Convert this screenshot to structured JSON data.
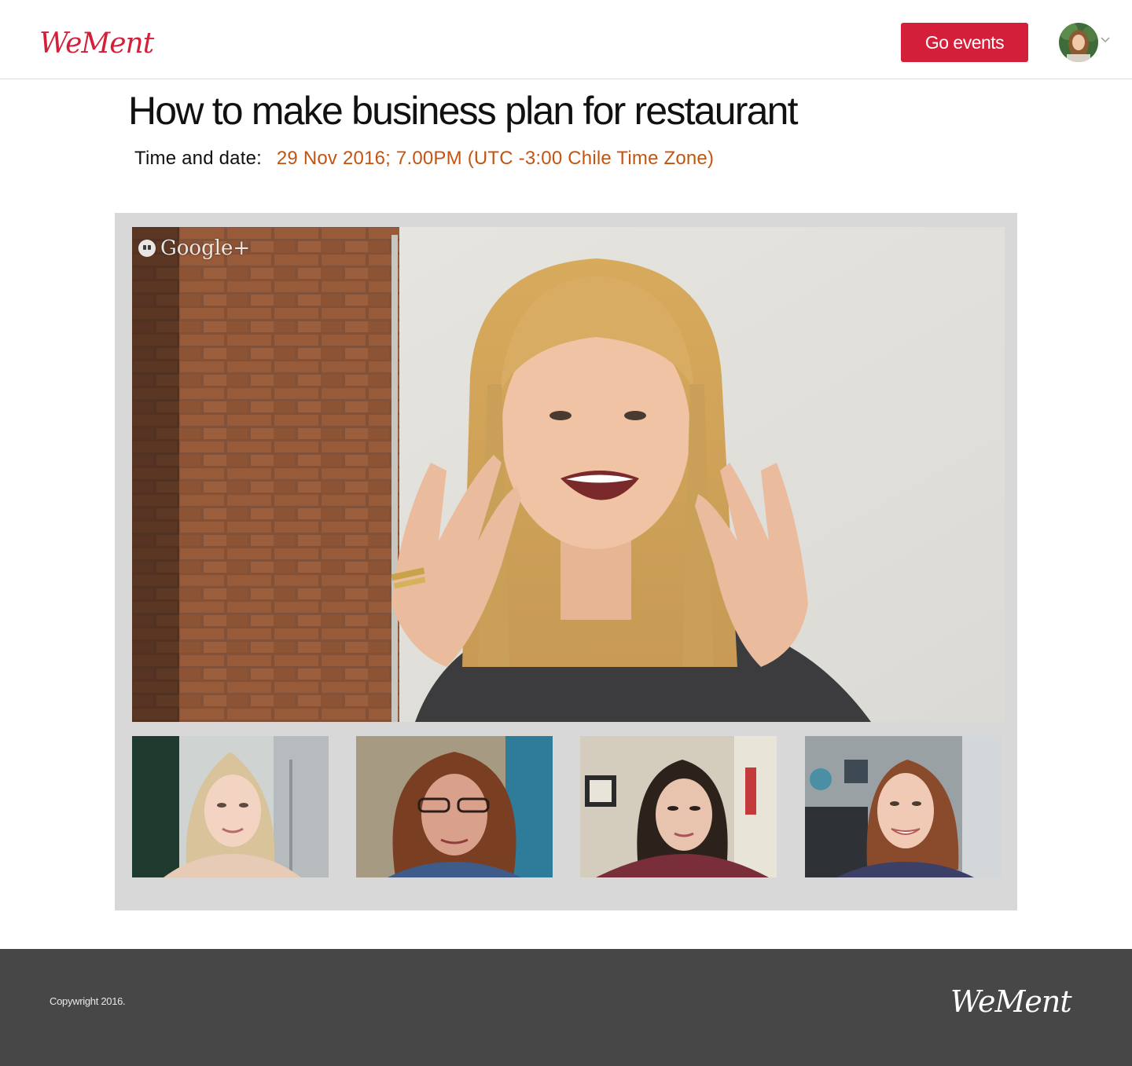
{
  "header": {
    "logo_text": "WeMent",
    "go_events_label": "Go events"
  },
  "event": {
    "title": "How to make business plan for restaurant",
    "time_label": "Time and date:",
    "time_value": "29 Nov 2016; 7.00PM (UTC -3:00 Chile Time Zone)"
  },
  "video": {
    "overlay_brand": "Google+",
    "participants": [
      {
        "id": "participant-1"
      },
      {
        "id": "participant-2"
      },
      {
        "id": "participant-3"
      },
      {
        "id": "participant-4"
      }
    ]
  },
  "footer": {
    "copyright": "Copywright 2016.",
    "logo_text": "WeMent"
  },
  "colors": {
    "brand_red": "#d41f3a",
    "date_orange": "#c45511",
    "panel_gray": "#d8d8d8",
    "footer_bg": "#474747"
  }
}
